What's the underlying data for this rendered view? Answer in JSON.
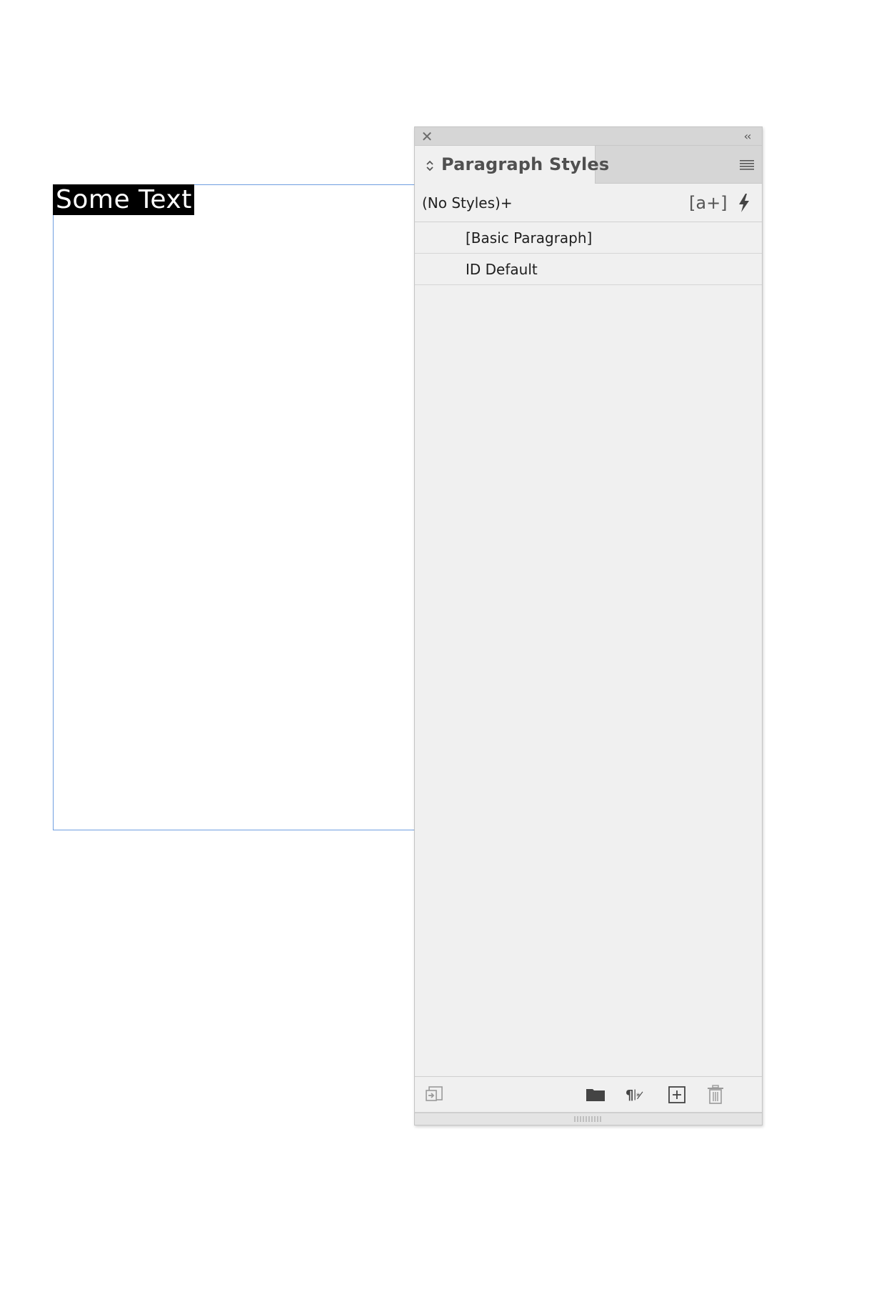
{
  "canvas": {
    "selected_text": "Some Text"
  },
  "panel": {
    "title": "Paragraph Styles",
    "current_style": "(No Styles)+",
    "create_style_icon_text": "[a+]",
    "icons": {
      "close": "close-icon",
      "collapse": "collapse-double-chevron-icon",
      "tab_arrows": "up-down-arrows-icon",
      "menu": "hamburger-menu-icon",
      "quick_apply": "lightning-bolt-icon",
      "footer": [
        "load-styles-icon",
        "new-group-folder-icon",
        "clear-overrides-icon",
        "new-style-icon",
        "delete-trash-icon"
      ]
    },
    "styles": [
      {
        "label": "[Basic Paragraph]"
      },
      {
        "label": "ID Default"
      }
    ]
  },
  "colors": {
    "frame_border": "#6f9ee0",
    "panel_bg": "#f0f0f0",
    "titlebar_bg": "#d6d6d6",
    "selection_bg": "#000000"
  }
}
